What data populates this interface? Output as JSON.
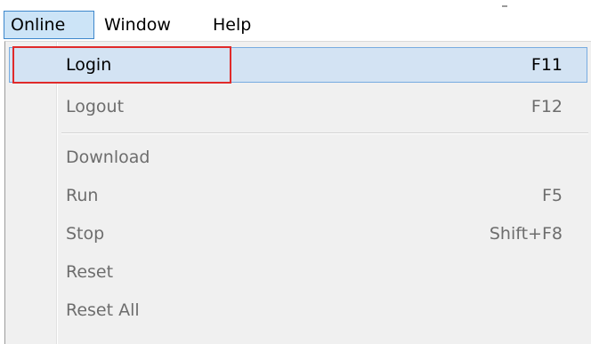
{
  "menubar": {
    "items": [
      {
        "label": "Online",
        "active": true
      },
      {
        "label": "Window",
        "active": false
      },
      {
        "label": "Help",
        "active": false
      }
    ]
  },
  "dropdown": {
    "items": [
      {
        "label": "Login",
        "shortcut": "F11",
        "state": "highlighted"
      },
      {
        "label": "Logout",
        "shortcut": "F12",
        "state": "disabled"
      },
      {
        "label": "Download",
        "shortcut": "",
        "state": "disabled"
      },
      {
        "label": "Run",
        "shortcut": "F5",
        "state": "disabled"
      },
      {
        "label": "Stop",
        "shortcut": "Shift+F8",
        "state": "disabled"
      },
      {
        "label": "Reset",
        "shortcut": "",
        "state": "disabled"
      },
      {
        "label": "Reset All",
        "shortcut": "",
        "state": "disabled"
      }
    ]
  },
  "colors": {
    "highlight_fill": "#d3e3f3",
    "highlight_border": "#77abe0",
    "annotation_box": "#e02a2a",
    "disabled_text": "#6d6d6d"
  }
}
